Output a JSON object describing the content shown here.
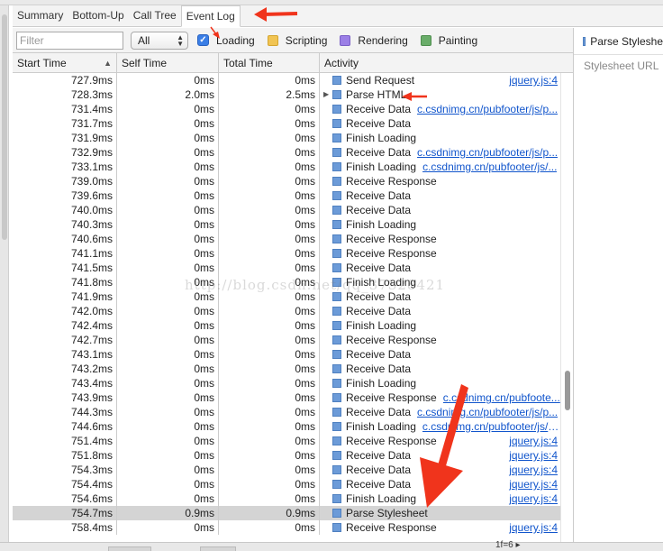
{
  "tabs": [
    {
      "label": "Summary"
    },
    {
      "label": "Bottom-Up"
    },
    {
      "label": "Call Tree"
    },
    {
      "label": "Event Log"
    }
  ],
  "filter": {
    "placeholder": "Filter",
    "select_value": "All",
    "categories": [
      {
        "label": "Loading",
        "color": "#3a7ee6",
        "checked": true
      },
      {
        "label": "Scripting",
        "color": "#f1c453"
      },
      {
        "label": "Rendering",
        "color": "#9b7fe6"
      },
      {
        "label": "Painting",
        "color": "#6aad6a"
      }
    ]
  },
  "columns": {
    "start": "Start Time",
    "self": "Self Time",
    "total": "Total Time",
    "activity": "Activity"
  },
  "rows": [
    {
      "start": "727.9ms",
      "self": "0ms",
      "total": "0ms",
      "activity": "Send Request",
      "link": "",
      "rlink": "jquery.js:4"
    },
    {
      "start": "728.3ms",
      "self": "2.0ms",
      "total": "2.5ms",
      "activity": "Parse HTML",
      "link": "",
      "rlink": "",
      "expand": true
    },
    {
      "start": "731.4ms",
      "self": "0ms",
      "total": "0ms",
      "activity": "Receive Data",
      "link": "c.csdnimg.cn/pubfooter/js/p...",
      "rlink": ""
    },
    {
      "start": "731.7ms",
      "self": "0ms",
      "total": "0ms",
      "activity": "Receive Data",
      "link": "",
      "rlink": ""
    },
    {
      "start": "731.9ms",
      "self": "0ms",
      "total": "0ms",
      "activity": "Finish Loading",
      "link": "",
      "rlink": ""
    },
    {
      "start": "732.9ms",
      "self": "0ms",
      "total": "0ms",
      "activity": "Receive Data",
      "link": "c.csdnimg.cn/pubfooter/js/p...",
      "rlink": ""
    },
    {
      "start": "733.1ms",
      "self": "0ms",
      "total": "0ms",
      "activity": "Finish Loading",
      "link": "c.csdnimg.cn/pubfooter/js/...",
      "rlink": ""
    },
    {
      "start": "739.0ms",
      "self": "0ms",
      "total": "0ms",
      "activity": "Receive Response",
      "link": "",
      "rlink": ""
    },
    {
      "start": "739.6ms",
      "self": "0ms",
      "total": "0ms",
      "activity": "Receive Data",
      "link": "",
      "rlink": ""
    },
    {
      "start": "740.0ms",
      "self": "0ms",
      "total": "0ms",
      "activity": "Receive Data",
      "link": "",
      "rlink": ""
    },
    {
      "start": "740.3ms",
      "self": "0ms",
      "total": "0ms",
      "activity": "Finish Loading",
      "link": "",
      "rlink": ""
    },
    {
      "start": "740.6ms",
      "self": "0ms",
      "total": "0ms",
      "activity": "Receive Response",
      "link": "",
      "rlink": ""
    },
    {
      "start": "741.1ms",
      "self": "0ms",
      "total": "0ms",
      "activity": "Receive Response",
      "link": "",
      "rlink": ""
    },
    {
      "start": "741.5ms",
      "self": "0ms",
      "total": "0ms",
      "activity": "Receive Data",
      "link": "",
      "rlink": ""
    },
    {
      "start": "741.8ms",
      "self": "0ms",
      "total": "0ms",
      "activity": "Finish Loading",
      "link": "",
      "rlink": ""
    },
    {
      "start": "741.9ms",
      "self": "0ms",
      "total": "0ms",
      "activity": "Receive Data",
      "link": "",
      "rlink": ""
    },
    {
      "start": "742.0ms",
      "self": "0ms",
      "total": "0ms",
      "activity": "Receive Data",
      "link": "",
      "rlink": ""
    },
    {
      "start": "742.4ms",
      "self": "0ms",
      "total": "0ms",
      "activity": "Finish Loading",
      "link": "",
      "rlink": ""
    },
    {
      "start": "742.7ms",
      "self": "0ms",
      "total": "0ms",
      "activity": "Receive Response",
      "link": "",
      "rlink": ""
    },
    {
      "start": "743.1ms",
      "self": "0ms",
      "total": "0ms",
      "activity": "Receive Data",
      "link": "",
      "rlink": ""
    },
    {
      "start": "743.2ms",
      "self": "0ms",
      "total": "0ms",
      "activity": "Receive Data",
      "link": "",
      "rlink": ""
    },
    {
      "start": "743.4ms",
      "self": "0ms",
      "total": "0ms",
      "activity": "Finish Loading",
      "link": "",
      "rlink": ""
    },
    {
      "start": "743.9ms",
      "self": "0ms",
      "total": "0ms",
      "activity": "Receive Response",
      "link": "c.csdnimg.cn/pubfoote...",
      "rlink": ""
    },
    {
      "start": "744.3ms",
      "self": "0ms",
      "total": "0ms",
      "activity": "Receive Data",
      "link": "c.csdnimg.cn/pubfooter/js/p...",
      "rlink": ""
    },
    {
      "start": "744.6ms",
      "self": "0ms",
      "total": "0ms",
      "activity": "Finish Loading",
      "link": "c.csdnimg.cn/pubfooter/js/p...",
      "rlink": ""
    },
    {
      "start": "751.4ms",
      "self": "0ms",
      "total": "0ms",
      "activity": "Receive Response",
      "link": "",
      "rlink": "jquery.js:4"
    },
    {
      "start": "751.8ms",
      "self": "0ms",
      "total": "0ms",
      "activity": "Receive Data",
      "link": "",
      "rlink": "jquery.js:4"
    },
    {
      "start": "754.3ms",
      "self": "0ms",
      "total": "0ms",
      "activity": "Receive Data",
      "link": "",
      "rlink": "jquery.js:4"
    },
    {
      "start": "754.4ms",
      "self": "0ms",
      "total": "0ms",
      "activity": "Receive Data",
      "link": "",
      "rlink": "jquery.js:4"
    },
    {
      "start": "754.6ms",
      "self": "0ms",
      "total": "0ms",
      "activity": "Finish Loading",
      "link": "",
      "rlink": "jquery.js:4"
    },
    {
      "start": "754.7ms",
      "self": "0.9ms",
      "total": "0.9ms",
      "activity": "Parse Stylesheet",
      "link": "",
      "rlink": "",
      "selected": true
    },
    {
      "start": "758.4ms",
      "self": "0ms",
      "total": "0ms",
      "activity": "Receive Response",
      "link": "",
      "rlink": "jquery.js:4"
    }
  ],
  "details": {
    "title": "Parse Styleshe",
    "property": "Stylesheet URL"
  },
  "watermark": "http://blog.csdn.net/qq_37328421",
  "status_fragment": "1f=6  ▸",
  "colors": {
    "event_square": "#6c9bd8",
    "link": "#1155cc",
    "annotation_arrow": "#f0341c"
  }
}
